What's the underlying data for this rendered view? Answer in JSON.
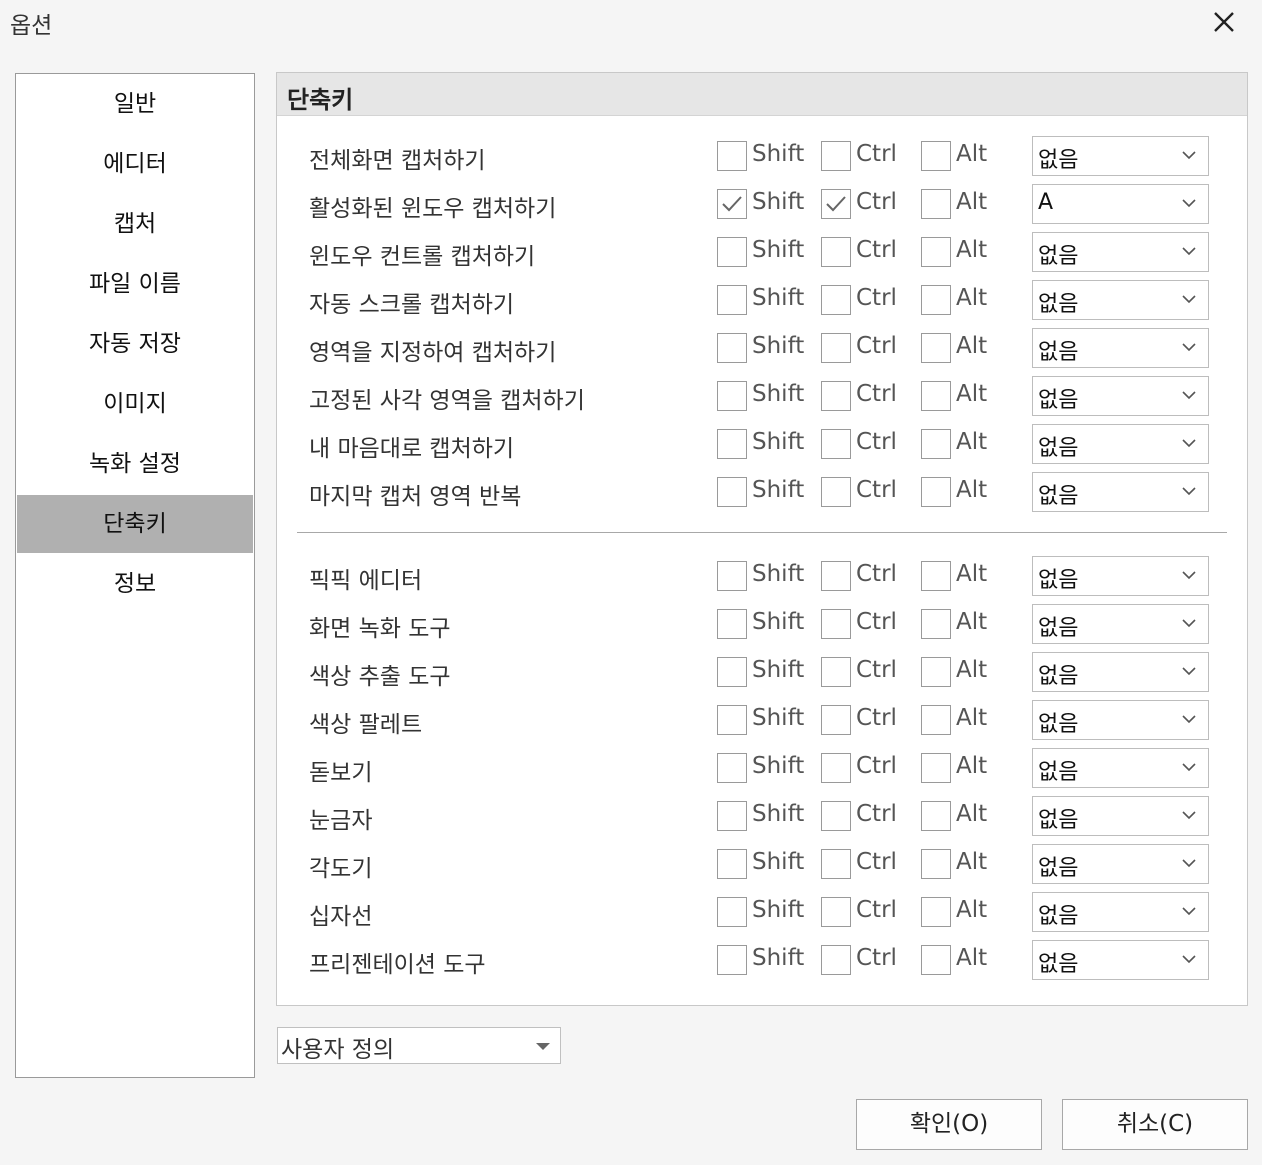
{
  "window": {
    "title": "옵션"
  },
  "sidebar": {
    "items": [
      {
        "label": "일반"
      },
      {
        "label": "에디터"
      },
      {
        "label": "캡처"
      },
      {
        "label": "파일 이름"
      },
      {
        "label": "자동 저장"
      },
      {
        "label": "이미지"
      },
      {
        "label": "녹화 설정"
      },
      {
        "label": "단축키",
        "selected": true
      },
      {
        "label": "정보"
      }
    ]
  },
  "panel": {
    "title": "단축키",
    "modifier_labels": {
      "shift": "Shift",
      "ctrl": "Ctrl",
      "alt": "Alt"
    },
    "capture_rows": [
      {
        "label": "전체화면 캡처하기",
        "shift": false,
        "ctrl": false,
        "alt": false,
        "key": "없음"
      },
      {
        "label": "활성화된 윈도우 캡처하기",
        "shift": true,
        "ctrl": true,
        "alt": false,
        "key": "A"
      },
      {
        "label": "윈도우 컨트롤 캡처하기",
        "shift": false,
        "ctrl": false,
        "alt": false,
        "key": "없음"
      },
      {
        "label": "자동 스크롤 캡처하기",
        "shift": false,
        "ctrl": false,
        "alt": false,
        "key": "없음"
      },
      {
        "label": "영역을 지정하여 캡처하기",
        "shift": false,
        "ctrl": false,
        "alt": false,
        "key": "없음"
      },
      {
        "label": "고정된 사각 영역을 캡처하기",
        "shift": false,
        "ctrl": false,
        "alt": false,
        "key": "없음"
      },
      {
        "label": "내 마음대로 캡처하기",
        "shift": false,
        "ctrl": false,
        "alt": false,
        "key": "없음"
      },
      {
        "label": "마지막 캡처 영역 반복",
        "shift": false,
        "ctrl": false,
        "alt": false,
        "key": "없음"
      }
    ],
    "tool_rows": [
      {
        "label": "픽픽 에디터",
        "shift": false,
        "ctrl": false,
        "alt": false,
        "key": "없음"
      },
      {
        "label": "화면 녹화 도구",
        "shift": false,
        "ctrl": false,
        "alt": false,
        "key": "없음"
      },
      {
        "label": "색상 추출 도구",
        "shift": false,
        "ctrl": false,
        "alt": false,
        "key": "없음"
      },
      {
        "label": "색상 팔레트",
        "shift": false,
        "ctrl": false,
        "alt": false,
        "key": "없음"
      },
      {
        "label": "돋보기",
        "shift": false,
        "ctrl": false,
        "alt": false,
        "key": "없음"
      },
      {
        "label": "눈금자",
        "shift": false,
        "ctrl": false,
        "alt": false,
        "key": "없음"
      },
      {
        "label": "각도기",
        "shift": false,
        "ctrl": false,
        "alt": false,
        "key": "없음"
      },
      {
        "label": "십자선",
        "shift": false,
        "ctrl": false,
        "alt": false,
        "key": "없음"
      },
      {
        "label": "프리젠테이션 도구",
        "shift": false,
        "ctrl": false,
        "alt": false,
        "key": "없음"
      }
    ]
  },
  "profile": {
    "value": "사용자 정의"
  },
  "buttons": {
    "ok": "확인(O)",
    "cancel": "취소(C)"
  },
  "icons": {
    "close": "close-icon",
    "dropdown": "chevron-down-icon",
    "check": "checkmark-icon"
  }
}
